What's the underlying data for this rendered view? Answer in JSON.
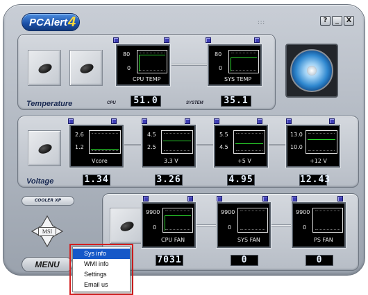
{
  "window": {
    "logo_text": "PCAlert",
    "logo_version": "4",
    "grip": ":::",
    "buttons": [
      "?",
      "_",
      "X"
    ]
  },
  "temperature": {
    "section_label": "Temperature",
    "cpu_label": "CPU",
    "system_label": "SYSTEM",
    "cpu_monitor": {
      "hi": "80",
      "lo": "0",
      "name": "CPU TEMP"
    },
    "sys_monitor": {
      "hi": "80",
      "lo": "0",
      "name": "SYS TEMP"
    },
    "cpu_readout": "51.0",
    "system_readout": "35.1"
  },
  "voltage": {
    "section_label": "Voltage",
    "monitors": [
      {
        "hi": "2.6",
        "lo": "1.2",
        "name": "Vcore",
        "readout": "1.34"
      },
      {
        "hi": "4.5",
        "lo": "2.5",
        "name": "3.3 V",
        "readout": "3.26"
      },
      {
        "hi": "5.5",
        "lo": "4.5",
        "name": "+5 V",
        "readout": "4.95"
      },
      {
        "hi": "13.0",
        "lo": "10.0",
        "name": "+12 V",
        "readout": "12.43"
      }
    ]
  },
  "fans": {
    "cooler_label": "COOLER XP",
    "monitors": [
      {
        "hi": "9900",
        "lo": "0",
        "name": "CPU FAN",
        "readout": "7031"
      },
      {
        "hi": "9900",
        "lo": "0",
        "name": "SYS FAN",
        "readout": "0"
      },
      {
        "hi": "9900",
        "lo": "0",
        "name": "PS FAN",
        "readout": "0"
      }
    ]
  },
  "msi_badge": "MSI",
  "menu_button": "MENU",
  "menu_items": [
    "Sys info",
    "WMI info",
    "Settings",
    "Email us"
  ],
  "colors": {
    "logo_blue": "#1a4fa6",
    "trace_green": "#29d12b",
    "menu_highlight": "#1558c8",
    "callout_red": "#d41e1e"
  }
}
